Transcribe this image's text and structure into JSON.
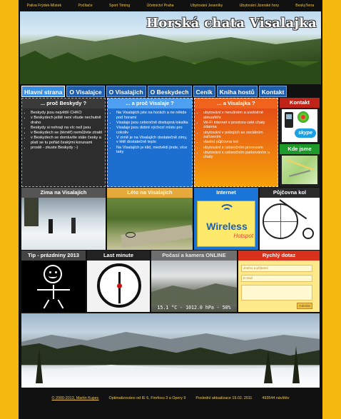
{
  "topnav": [
    "Paliva Frýdek-Místek",
    "Počítače",
    "Sport Timing",
    "Účetnictví Praha",
    "Ubytování Jeseníky",
    "Ubytování Jizerské hory",
    "BeskyTerra"
  ],
  "banner": {
    "title": "Horská chata Visalajka"
  },
  "mainnav": [
    "Hlavní strana",
    "O Visalajce",
    "O Visalajích",
    "O Beskydech",
    "Ceník",
    "Kniha hostů",
    "Kontakt"
  ],
  "col1": {
    "title": "... proč Beskydy ?",
    "items": [
      "Beskydy jsou největší CHKO",
      "v Beskydech ještě není všude nechutně draho",
      "Beskydy si nehrají na víc než jsou",
      "v Beskydech se (téměř) nemůžete ztratit",
      "v Beskydech se domluvíte stále česky a platí se tu pořád českými korunami",
      "prostě - zkuste Beskydy :-)"
    ]
  },
  "col2": {
    "title": "... a proč Visalaje ?",
    "items": [
      "Na Visalajích jste na horách a ne někde pod horami",
      "Visalaje jsou celoročně dostupná lokalita",
      "Visalaje jsou dobré výchozí místo pro cokoliv",
      "V zimě je na Visalajích dostatečně zimy, v létě dostatečně teplo",
      "Na Visalajích je klid, medvědi jinde, více taky"
    ]
  },
  "col3": {
    "title": "... a Visalajka ?",
    "items": [
      "ubytování v nerušném a uvolněné atmosféře",
      "Wi-Fi internet v prostoru celé chaty zdarma",
      "ubytování v pokojích se sociálním zařízením",
      "vlastní půjčovna kol",
      "ubytování s celoročním provozem",
      "ubytování s celoročním parkováním u chaty"
    ]
  },
  "contact": {
    "title": "Kontakt",
    "skype": "skype",
    "where": "Kde jsme"
  },
  "row2": {
    "winter": "Zima na Visalajích",
    "summer": "Léto na Visalajích",
    "internet": "Internet",
    "wireless_word": "Wireless",
    "wireless_sub": "Hotspot",
    "bikes": "Půjčovna kol"
  },
  "row3": {
    "tip": "Tip - prázdniny 2013",
    "lastminute": "Last minute",
    "weather": "Počasí a kamera ONLINE",
    "weather_reading": "15.1 °C - 1012.0 hPa - 50%",
    "query": "Rychlý dotaz",
    "query_name_ph": "Jméno a příjmení",
    "query_mail_ph": "E-mail",
    "query_send": "Odeslat"
  },
  "footer": {
    "copyright": "© 2000-2013, Martin Kupec",
    "optimized": "Optimalizováno od IE 6, Firefoxu 3 a Opery 9",
    "updated": "Poslední aktualizace 19.02. 2011",
    "visits": "493544 návštěv"
  }
}
